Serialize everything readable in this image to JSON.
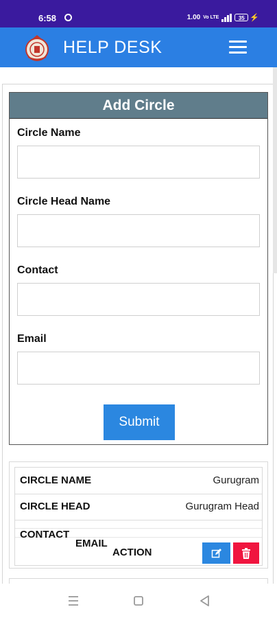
{
  "status_bar": {
    "time": "6:58",
    "network_speed": "1.00",
    "network_type": "Vo LTE",
    "battery": "35",
    "icons": [
      "whatsapp-icon",
      "signal-icon",
      "battery-icon",
      "charging-icon"
    ]
  },
  "app_bar": {
    "title": "HELP DESK",
    "logo": "haryana-emblem",
    "menu_icon": "hamburger-menu-icon"
  },
  "form": {
    "heading": "Add Circle",
    "fields": [
      {
        "label": "Circle Name",
        "value": "",
        "placeholder": ""
      },
      {
        "label": "Circle Head Name",
        "value": "",
        "placeholder": ""
      },
      {
        "label": "Contact",
        "value": "",
        "placeholder": ""
      },
      {
        "label": "Email",
        "value": "",
        "placeholder": ""
      }
    ],
    "submit_label": "Submit"
  },
  "record": {
    "circle_name_label": "CIRCLE NAME",
    "circle_name_value": "Gurugram",
    "circle_head_label": "CIRCLE HEAD",
    "circle_head_value": "Gurugram Head",
    "contact_label": "CONTACT",
    "email_label": "EMAIL",
    "action_label": "ACTION",
    "edit_icon": "edit-icon",
    "delete_icon": "trash-icon"
  },
  "colors": {
    "status_bar": "#3a1a9e",
    "app_bar": "#2b7fe3",
    "form_header": "#607d8b",
    "submit": "#2b87e0",
    "edit": "#2b87e0",
    "delete": "#f0153f"
  },
  "nav_bar": [
    "recent-apps-icon",
    "home-icon",
    "back-icon"
  ]
}
